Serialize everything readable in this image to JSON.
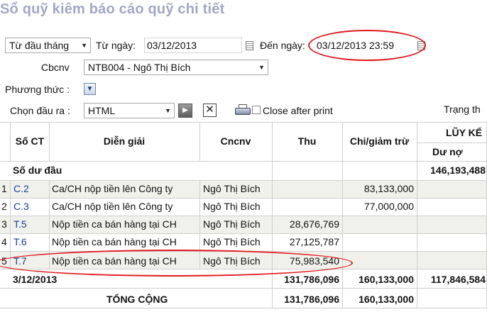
{
  "page_title": "Sổ quỹ kiêm báo cáo quỹ chi tiết",
  "filters": {
    "period_select": "Từ đầu tháng",
    "from_label": "Từ ngày:",
    "from_value": "03/12/2013",
    "to_label": "Đến ngày:",
    "to_value": "03/12/2013 23:59",
    "employee_label": "Cbcnv",
    "employee_value": "NTB004 - Ngô Thị Bích",
    "method_label": "Phương thức :",
    "output_label": "Chọn đầu ra :",
    "output_value": "HTML",
    "close_after_print": "Close after print",
    "status_label": "Trạng th"
  },
  "table": {
    "headers": {
      "so_ct": "Số CT",
      "dien_giai": "Diễn giải",
      "cncnv": "Cncnv",
      "thu": "Thu",
      "chi": "Chi/giảm trừ",
      "luy_ke": "LŨY KẾ",
      "du_no": "Dư nợ"
    },
    "opening": {
      "label": "Số dư đầu",
      "du_no": "146,193,488"
    },
    "rows": [
      {
        "idx": "1",
        "so_ct": "C.2",
        "dien_giai": "Ca/CH nộp tiền lên Công ty",
        "cncnv": "Ngô Thị Bích",
        "thu": "",
        "chi": "83,133,000"
      },
      {
        "idx": "2",
        "so_ct": "C.3",
        "dien_giai": "Ca/CH nộp tiền lên Công ty",
        "cncnv": "Ngô Thị Bích",
        "thu": "",
        "chi": "77,000,000"
      },
      {
        "idx": "3",
        "so_ct": "T.5",
        "dien_giai": "Nộp tiền ca bán hàng tại CH",
        "cncnv": "Ngô Thị Bích",
        "thu": "28,676,769",
        "chi": ""
      },
      {
        "idx": "4",
        "so_ct": "T.6",
        "dien_giai": "Nộp tiền ca bán hàng tại CH",
        "cncnv": "Ngô Thị Bích",
        "thu": "27,125,787",
        "chi": ""
      },
      {
        "idx": "5",
        "so_ct": "T.7",
        "dien_giai": "Nộp tiền ca bán hàng tại CH",
        "cncnv": "Ngô Thị Bích",
        "thu": "75,983,540",
        "chi": ""
      }
    ],
    "subtotal": {
      "label": "3/12/2013",
      "thu": "131,786,096",
      "chi": "160,133,000",
      "du_no": "117,846,584"
    },
    "total": {
      "label": "TỔNG CỘNG",
      "thu": "131,786,096",
      "chi": "160,133,000"
    }
  }
}
